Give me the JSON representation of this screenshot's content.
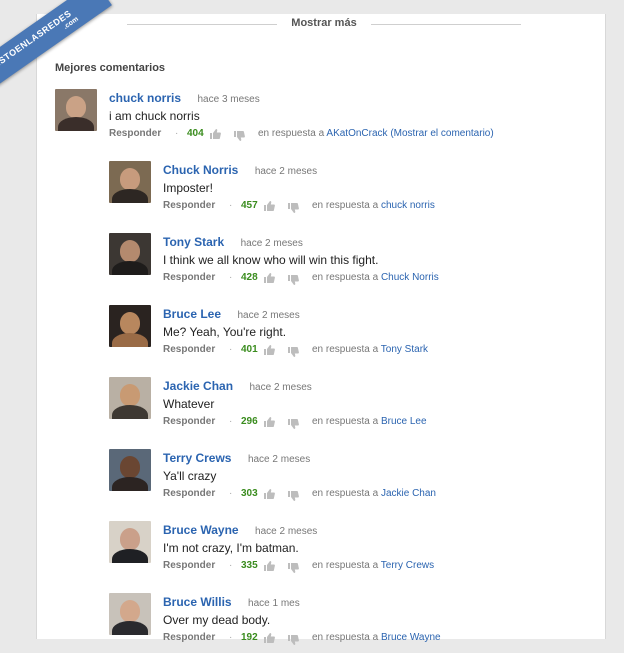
{
  "show_more_label": "Mostrar más",
  "section_title": "Mejores comentarios",
  "watermark": {
    "brand": "VISTOENLASREDES",
    "tld": ".com"
  },
  "reply_label": "Responder",
  "reply_prefix": "en respuesta a",
  "colors": {
    "author_link": "#2b64b0",
    "likes": "#3a8c1e",
    "watermark": "#4a78b6"
  },
  "comments": [
    {
      "author": "chuck norris",
      "time": "hace 3 meses",
      "text": "i am chuck norris",
      "likes": "404",
      "reply_to": "AKatOnCrack (Mostrar el comentario)"
    },
    {
      "author": "Chuck Norris",
      "time": "hace 2 meses",
      "text": "Imposter!",
      "likes": "457",
      "reply_to": "chuck norris"
    },
    {
      "author": "Tony Stark",
      "time": "hace 2 meses",
      "text": "I think we all know who will win this fight.",
      "likes": "428",
      "reply_to": "Chuck Norris"
    },
    {
      "author": "Bruce Lee",
      "time": "hace 2 meses",
      "text": "Me? Yeah, You're right.",
      "likes": "401",
      "reply_to": "Tony Stark"
    },
    {
      "author": "Jackie Chan",
      "time": "hace 2 meses",
      "text": "Whatever",
      "likes": "296",
      "reply_to": "Bruce Lee"
    },
    {
      "author": "Terry Crews",
      "time": "hace 2 meses",
      "text": "Ya'll crazy",
      "likes": "303",
      "reply_to": "Jackie Chan"
    },
    {
      "author": "Bruce Wayne",
      "time": "hace 2 meses",
      "text": "I'm not crazy, I'm batman.",
      "likes": "335",
      "reply_to": "Terry Crews"
    },
    {
      "author": "Bruce Willis",
      "time": "hace 1 mes",
      "text": "Over my dead body.",
      "likes": "192",
      "reply_to": "Bruce Wayne"
    }
  ]
}
